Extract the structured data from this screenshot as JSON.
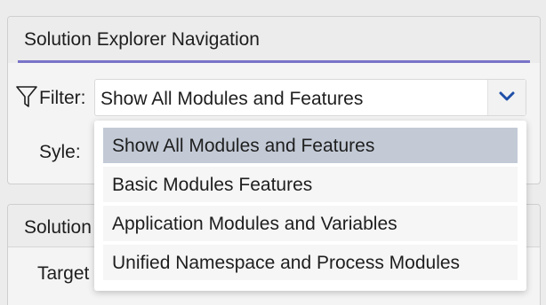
{
  "panel_top": {
    "title": "Solution Explorer Navigation",
    "filter_label": "Filter:",
    "style_label": "Syle:",
    "filter_combo": {
      "selected_value": "Show All Modules and Features"
    },
    "dropdown": {
      "options": [
        "Show All Modules and Features",
        "Basic Modules Features",
        "Application Modules and Variables",
        "Unified Namespace and Process Modules"
      ],
      "selected_index": 0
    }
  },
  "panel_bottom": {
    "title_partial": "Solution",
    "row_label_partial": "Target"
  },
  "colors": {
    "accent_underline": "#7a74c9",
    "chevron": "#1f4fa8",
    "selected_item_bg": "#c3cad6"
  },
  "icons": {
    "filter": "filter-funnel-icon",
    "combo_arrow": "chevron-down-icon"
  }
}
